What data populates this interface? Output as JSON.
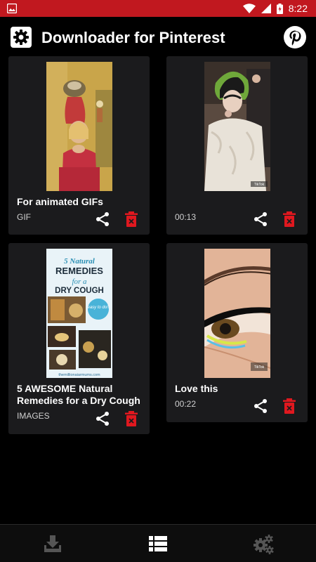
{
  "status_bar": {
    "time": "8:22",
    "icons": [
      "image-icon",
      "wifi-icon",
      "signal-icon",
      "battery-charging-icon"
    ]
  },
  "app_bar": {
    "title": "Downloader for Pinterest",
    "left_icon": "settings-icon",
    "right_icon": "pinterest-icon"
  },
  "cards": [
    {
      "title": "For animated GIFs",
      "meta": "GIF"
    },
    {
      "title": "",
      "meta": "00:13"
    },
    {
      "title": "5 AWESOME Natural Remedies for a Dry Cough",
      "meta": "IMAGES"
    },
    {
      "title": "Love this",
      "meta": "00:22"
    }
  ],
  "thumb_text": {
    "remedies_line1": "5 Natural",
    "remedies_line2": "REMEDIES",
    "remedies_line3": "for a",
    "remedies_line4": "DRY COUGH",
    "remedies_badge": "easy to do!!",
    "remedies_footer": "themillionaiarmums.com",
    "tiktok_label": "TikTok"
  },
  "bottom_nav": {
    "items": [
      "download-icon",
      "list-icon",
      "settings-icon"
    ],
    "active": "list-icon"
  },
  "colors": {
    "status_bar": "#c1181f",
    "background": "#000000",
    "card": "#1b1b1d",
    "delete": "#e0181f"
  }
}
